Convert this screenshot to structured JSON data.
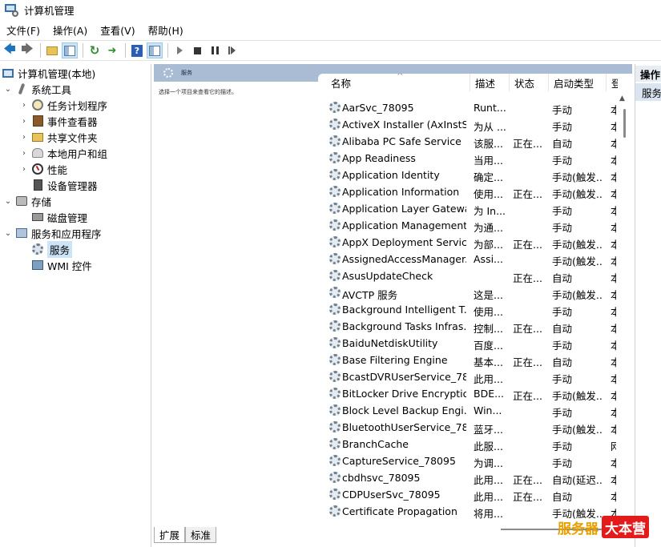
{
  "window": {
    "title": "计算机管理"
  },
  "menu": [
    "文件(F)",
    "操作(A)",
    "查看(V)",
    "帮助(H)"
  ],
  "toolbar": [
    "back-icon",
    "forward-icon",
    "up-folder-icon",
    "show-hide-tree-icon",
    "refresh-icon",
    "export-list-icon",
    "help-icon",
    "properties-panel-icon",
    "start-service-icon",
    "stop-service-icon",
    "pause-service-icon",
    "restart-service-icon"
  ],
  "tree": [
    {
      "label": "计算机管理(本地)",
      "icon": "computer-icon"
    },
    {
      "label": "系统工具",
      "icon": "tools-icon"
    },
    {
      "label": "任务计划程序",
      "icon": "clock-icon"
    },
    {
      "label": "事件查看器",
      "icon": "event-viewer-icon"
    },
    {
      "label": "共享文件夹",
      "icon": "shared-folder-icon"
    },
    {
      "label": "本地用户和组",
      "icon": "users-icon"
    },
    {
      "label": "性能",
      "icon": "performance-icon"
    },
    {
      "label": "设备管理器",
      "icon": "device-manager-icon"
    },
    {
      "label": "存储",
      "icon": "storage-icon"
    },
    {
      "label": "磁盘管理",
      "icon": "disk-icon"
    },
    {
      "label": "服务和应用程序",
      "icon": "services-apps-icon"
    },
    {
      "label": "服务",
      "icon": "services-gear-icon"
    },
    {
      "label": "WMI 控件",
      "icon": "wmi-icon"
    }
  ],
  "center": {
    "header": "服务",
    "description_hint": "选择一个项目来查看它的描述。"
  },
  "columns": [
    "名称",
    "描述",
    "状态",
    "启动类型",
    "登"
  ],
  "services": [
    {
      "name": "AarSvc_78095",
      "desc": "Runt...",
      "status": "",
      "startup": "手动",
      "logon": "本"
    },
    {
      "name": "ActiveX Installer (AxInstSV)",
      "desc": "为从 ...",
      "status": "",
      "startup": "手动",
      "logon": "本"
    },
    {
      "name": "Alibaba PC Safe Service",
      "desc": "该服...",
      "status": "正在...",
      "startup": "自动",
      "logon": "本"
    },
    {
      "name": "App Readiness",
      "desc": "当用...",
      "status": "",
      "startup": "手动",
      "logon": "本"
    },
    {
      "name": "Application Identity",
      "desc": "确定...",
      "status": "",
      "startup": "手动(触发...",
      "logon": "本"
    },
    {
      "name": "Application Information",
      "desc": "使用...",
      "status": "正在...",
      "startup": "手动(触发...",
      "logon": "本"
    },
    {
      "name": "Application Layer Gatewa...",
      "desc": "为 In...",
      "status": "",
      "startup": "手动",
      "logon": "本"
    },
    {
      "name": "Application Management",
      "desc": "为通...",
      "status": "",
      "startup": "手动",
      "logon": "本"
    },
    {
      "name": "AppX Deployment Servic...",
      "desc": "为部...",
      "status": "正在...",
      "startup": "手动(触发...",
      "logon": "本"
    },
    {
      "name": "AssignedAccessManager...",
      "desc": "Assi...",
      "status": "",
      "startup": "手动(触发...",
      "logon": "本"
    },
    {
      "name": "AsusUpdateCheck",
      "desc": "",
      "status": "正在...",
      "startup": "自动",
      "logon": "本"
    },
    {
      "name": "AVCTP 服务",
      "desc": "这是...",
      "status": "",
      "startup": "手动(触发...",
      "logon": "本"
    },
    {
      "name": "Background Intelligent T...",
      "desc": "使用...",
      "status": "",
      "startup": "手动",
      "logon": "本"
    },
    {
      "name": "Background Tasks Infras...",
      "desc": "控制...",
      "status": "正在...",
      "startup": "自动",
      "logon": "本"
    },
    {
      "name": "BaiduNetdiskUtility",
      "desc": "百度...",
      "status": "",
      "startup": "手动",
      "logon": "本"
    },
    {
      "name": "Base Filtering Engine",
      "desc": "基本...",
      "status": "正在...",
      "startup": "自动",
      "logon": "本"
    },
    {
      "name": "BcastDVRUserService_78...",
      "desc": "此用...",
      "status": "",
      "startup": "手动",
      "logon": "本"
    },
    {
      "name": "BitLocker Drive Encryptio...",
      "desc": "BDE...",
      "status": "正在...",
      "startup": "手动(触发...",
      "logon": "本"
    },
    {
      "name": "Block Level Backup Engi...",
      "desc": "Win...",
      "status": "",
      "startup": "手动",
      "logon": "本"
    },
    {
      "name": "BluetoothUserService_78...",
      "desc": "蓝牙...",
      "status": "",
      "startup": "手动(触发...",
      "logon": "本"
    },
    {
      "name": "BranchCache",
      "desc": "此服...",
      "status": "",
      "startup": "手动",
      "logon": "网"
    },
    {
      "name": "CaptureService_78095",
      "desc": "为调...",
      "status": "",
      "startup": "手动",
      "logon": "本"
    },
    {
      "name": "cbdhsvc_78095",
      "desc": "此用...",
      "status": "正在...",
      "startup": "自动(延迟...",
      "logon": "本"
    },
    {
      "name": "CDPUserSvc_78095",
      "desc": "此用...",
      "status": "正在...",
      "startup": "自动",
      "logon": "本"
    },
    {
      "name": "Certificate Propagation",
      "desc": "将用...",
      "status": "",
      "startup": "手动(触发...",
      "logon": "本"
    }
  ],
  "tabs": [
    "扩展",
    "标准"
  ],
  "actions": {
    "title": "操作",
    "subtitle": "服务"
  },
  "watermark": {
    "a": "服务器",
    "b": "大本营"
  }
}
